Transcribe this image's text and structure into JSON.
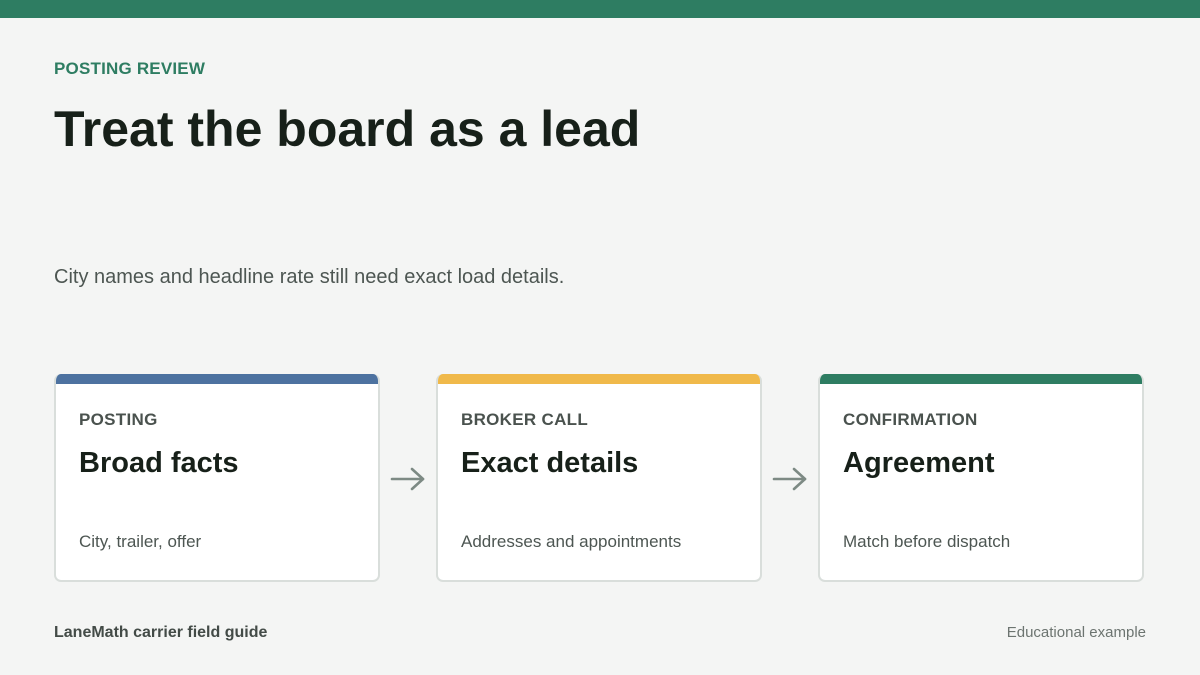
{
  "header": {
    "eyebrow": "POSTING REVIEW",
    "title": "Treat the board as a lead",
    "subtitle": "City names and headline rate still need exact load details."
  },
  "colors": {
    "brand": "#2e7d62",
    "posting": "#4d72a0",
    "broker_call": "#f0b94a",
    "confirmation": "#2e7d62",
    "arrow": "#7d8a84"
  },
  "steps": [
    {
      "label": "POSTING",
      "heading": "Broad facts",
      "note": "City, trailer, offer"
    },
    {
      "label": "BROKER CALL",
      "heading": "Exact details",
      "note": "Addresses and appointments"
    },
    {
      "label": "CONFIRMATION",
      "heading": "Agreement",
      "note": "Match before dispatch"
    }
  ],
  "arrows": [
    {
      "icon": "arrow-right-icon"
    },
    {
      "icon": "arrow-right-icon"
    }
  ],
  "footer": {
    "left": "LaneMath carrier field guide",
    "right": "Educational example"
  }
}
